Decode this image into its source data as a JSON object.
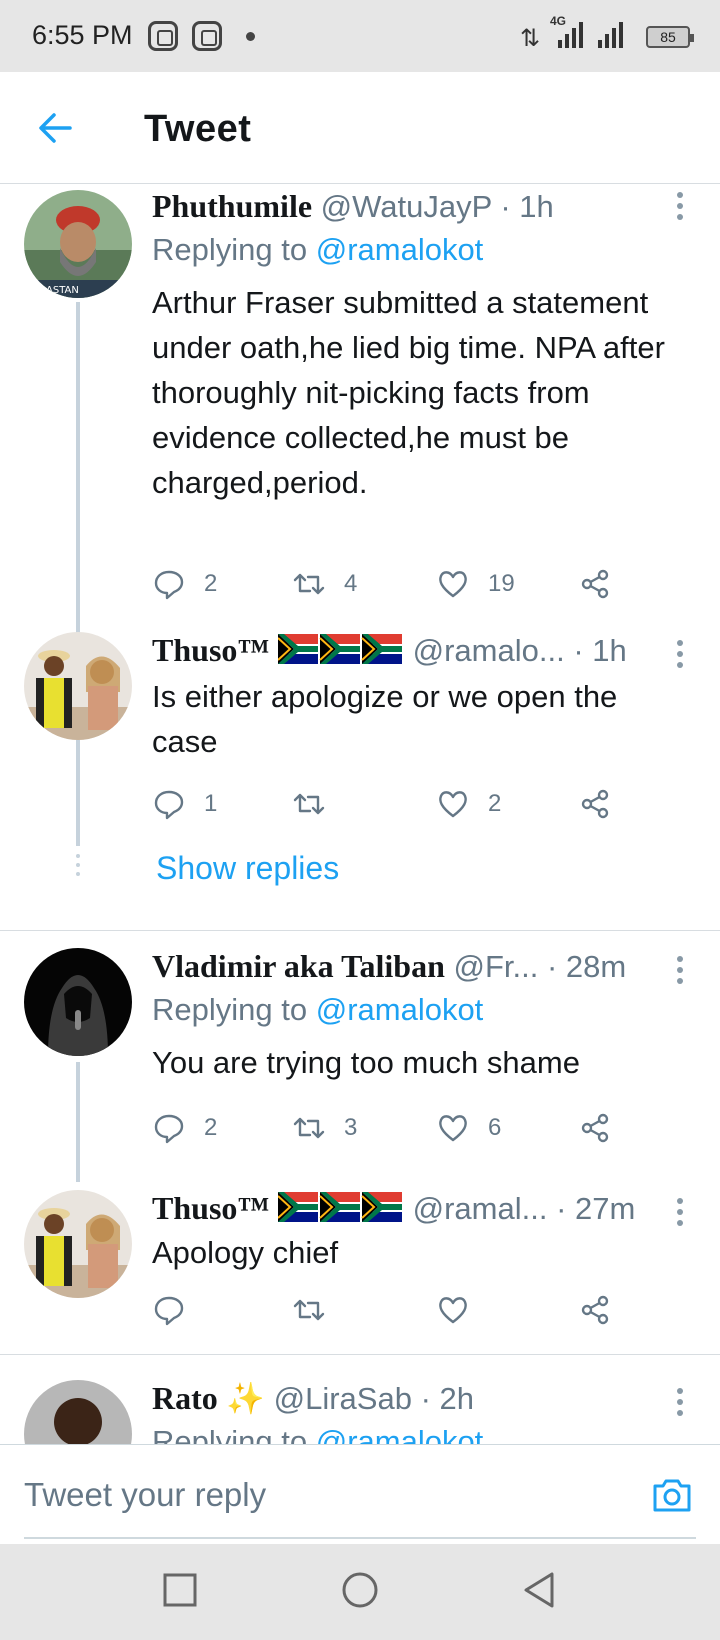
{
  "status_bar": {
    "time": "6:55 PM",
    "network": "4G",
    "battery": "85"
  },
  "header": {
    "title": "Tweet",
    "back_icon": "arrow-left-icon"
  },
  "colors": {
    "accent": "#1da1f2",
    "secondary_text": "#657786",
    "thread_line": "#c6d2dc"
  },
  "tweets": [
    {
      "name": "Phuthumile",
      "handle": "@WatuJayP",
      "time": "· 1h",
      "replying_label": "Replying to",
      "replying_to": "@ramalokot",
      "text": "Arthur Fraser submitted a statement under oath,he lied big time. NPA after thoroughly nit-picking facts from evidence collected,he must be charged,period.",
      "replies": "2",
      "retweets": "4",
      "likes": "19"
    },
    {
      "name": "Thuso™",
      "handle": "@ramalo...",
      "time": "· 1h",
      "text": "Is either apologize or we open the case",
      "replies": "1",
      "retweets": "",
      "likes": "2"
    },
    {
      "name": "Vladimir aka Taliban",
      "handle": "@Fr...",
      "time": "· 28m",
      "replying_label": "Replying to",
      "replying_to": "@ramalokot",
      "text": "You are trying too much shame",
      "replies": "2",
      "retweets": "3",
      "likes": "6"
    },
    {
      "name": "Thuso™",
      "handle": "@ramal...",
      "time": "· 27m",
      "text": "Apology chief",
      "replies": "",
      "retweets": "",
      "likes": ""
    },
    {
      "name": "Rato",
      "handle": "@LiraSab",
      "time": "· 2h",
      "replying_label": "Replying to",
      "replying_to": "@ramalokot"
    }
  ],
  "show_replies": "Show replies",
  "compose": {
    "placeholder": "Tweet your reply",
    "camera_icon": "camera-icon"
  },
  "nav": {
    "icons": [
      "square-icon",
      "circle-icon",
      "triangle-back-icon"
    ]
  }
}
